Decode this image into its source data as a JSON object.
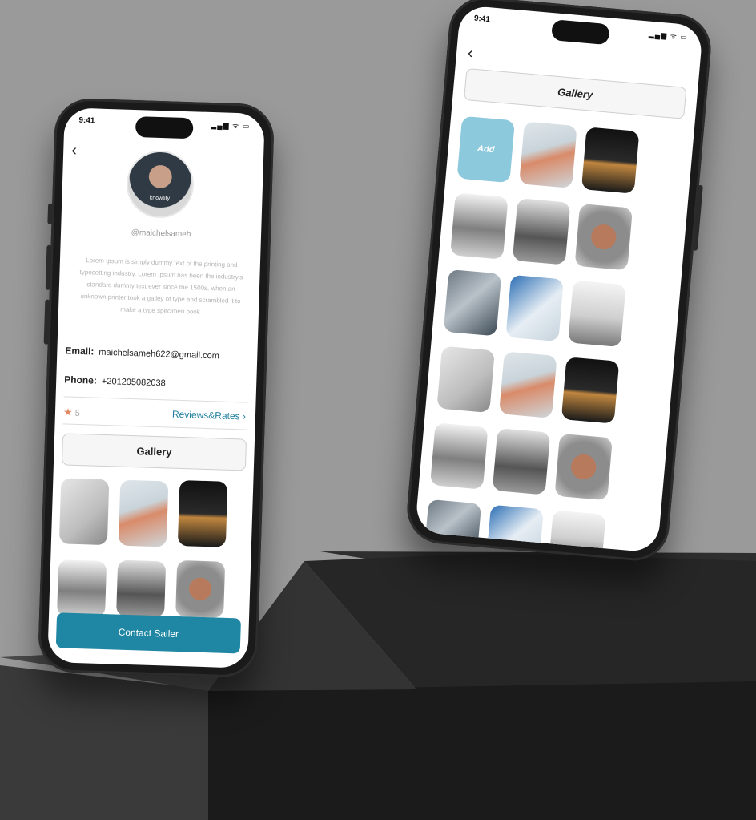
{
  "status": {
    "time": "9:41",
    "icons": "▂▄▆ ᯤ ▭"
  },
  "left_screen": {
    "username": "@maichelsameh",
    "avatar_badge": "knowtify",
    "bio": "Lorem Ipsum is simply dummy text of the printing and typesetting industry. Lorem Ipsum has been the industry's standard dummy text ever since the 1500s, when an unknown printer took a galley of type and scrambled it to make a type specimen book",
    "email_label": "Email:",
    "email_value": "maichelsameh622@gmail.com",
    "phone_label": "Phone:",
    "phone_value": "+201205082038",
    "rating_value": "5",
    "reviews_link": "Reviews&Rates ›",
    "gallery_label": "Gallery",
    "contact_label": "Contact Saller"
  },
  "right_screen": {
    "gallery_title": "Gallery",
    "add_label": "Add"
  },
  "colors": {
    "accent": "#1f87a3",
    "add_tile": "#8cc9dd",
    "star": "#e08a63"
  }
}
